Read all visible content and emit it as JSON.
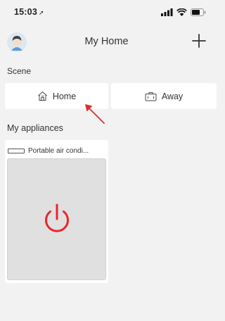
{
  "status_bar": {
    "time": "15:03",
    "location_icon": "location-arrow-icon",
    "icons": [
      "signal-icon",
      "wifi-icon",
      "battery-icon"
    ]
  },
  "header": {
    "title": "My Home",
    "avatar_icon": "user-avatar-icon",
    "add_icon": "plus-icon"
  },
  "scene_section": {
    "label": "Scene",
    "scenes": [
      {
        "label": "Home",
        "icon": "house-icon"
      },
      {
        "label": "Away",
        "icon": "suitcase-icon"
      }
    ]
  },
  "appliances_section": {
    "label": "My appliances",
    "items": [
      {
        "name": "Portable air condi...",
        "icon": "air-conditioner-icon",
        "power_icon": "power-icon",
        "power_color": "#e8262a"
      }
    ]
  },
  "annotation": {
    "arrow_color": "#d9302e"
  }
}
